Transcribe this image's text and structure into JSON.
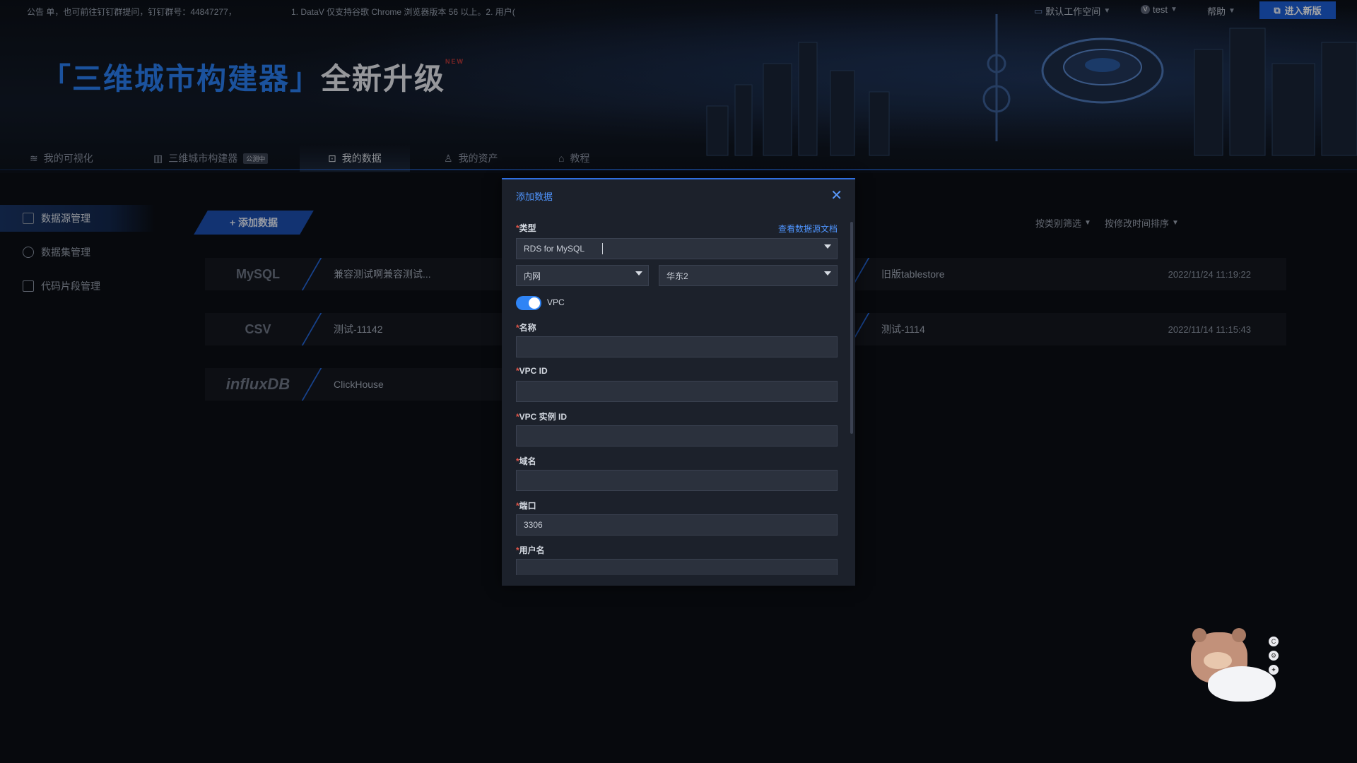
{
  "topbar": {
    "notice_left": "公告  单，也可前往钉钉群提问，钉钉群号：44847277，",
    "notice_right": "1. DataV 仅支持谷歌 Chrome 浏览器版本 56 以上。2. 用户(",
    "workspace": "默认工作空间",
    "user": "test",
    "help": "帮助",
    "enter_new": "进入新版"
  },
  "banner": {
    "part_blue": "「三维城市构建器」",
    "part_white": "全新升级",
    "badge": "NEW"
  },
  "nav": {
    "tabs": [
      {
        "label": "我的可视化"
      },
      {
        "label": "三维城市构建器",
        "badge": "公测中"
      },
      {
        "label": "我的数据"
      },
      {
        "label": "我的资产"
      },
      {
        "label": "教程"
      }
    ]
  },
  "sidebar": {
    "items": [
      {
        "label": "数据源管理"
      },
      {
        "label": "数据集管理"
      },
      {
        "label": "代码片段管理"
      }
    ]
  },
  "content": {
    "add_button": "+ 添加数据",
    "filter_type": "按类别筛选",
    "sort_time": "按修改时间排序",
    "left_cards": [
      {
        "logo": "MySQL",
        "title": "兼容测试啊兼容测试..."
      },
      {
        "logo": "CSV",
        "title": "测试-11142"
      },
      {
        "logo": "influxDB",
        "title": "ClickHouse"
      }
    ],
    "right_cards": [
      {
        "title": "旧版tablestore",
        "date": "2022/11/24 11:19:22"
      },
      {
        "title": "测试-1114",
        "date": "2022/11/14 11:15:43"
      }
    ]
  },
  "modal": {
    "title": "添加数据",
    "doc_link": "查看数据源文档",
    "type_label": "类型",
    "type_value": "RDS for MySQL",
    "network_value": "内网",
    "region_value": "华东2",
    "vpc_label": "VPC",
    "vpc_enabled": true,
    "name_label": "名称",
    "name_value": "",
    "vpc_id_label": "VPC ID",
    "vpc_id_value": "",
    "vpc_instance_label": "VPC 实例 ID",
    "vpc_instance_value": "",
    "domain_label": "域名",
    "domain_value": "",
    "port_label": "端口",
    "port_value": "3306",
    "username_label": "用户名",
    "username_value": ""
  },
  "colors": {
    "accent": "#2f6fe0",
    "link": "#4f95ff",
    "background": "#0b0e14"
  }
}
